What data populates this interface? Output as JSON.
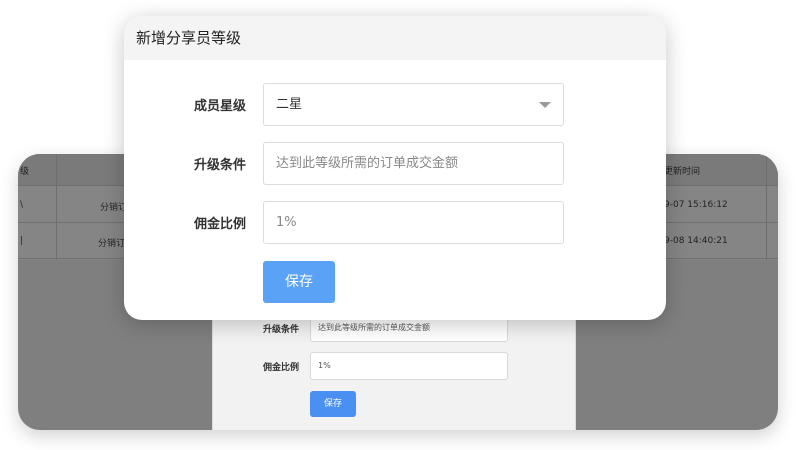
{
  "background": {
    "table": {
      "header": {
        "level_col": "级",
        "time_col": "更新时间"
      },
      "rows": [
        {
          "left_char": "\\",
          "type": "分销订",
          "time": "9-07 15:16:12"
        },
        {
          "left_char": "|",
          "type": "分销订",
          "time": "9-08 14:40:21"
        }
      ]
    },
    "inner_form": {
      "upgrade_label": "升级条件",
      "upgrade_placeholder": "达到此等级所需的订单成交金额",
      "commission_label": "佣金比例",
      "commission_value": "1%",
      "save_label": "保存"
    }
  },
  "modal": {
    "title": "新增分享员等级",
    "fields": {
      "level": {
        "label": "成员星级",
        "value": "二星"
      },
      "upgrade": {
        "label": "升级条件",
        "placeholder": "达到此等级所需的订单成交金额"
      },
      "commission": {
        "label": "佣金比例",
        "value": "1%"
      }
    },
    "save_label": "保存",
    "accent_color": "#5aa2f5"
  }
}
